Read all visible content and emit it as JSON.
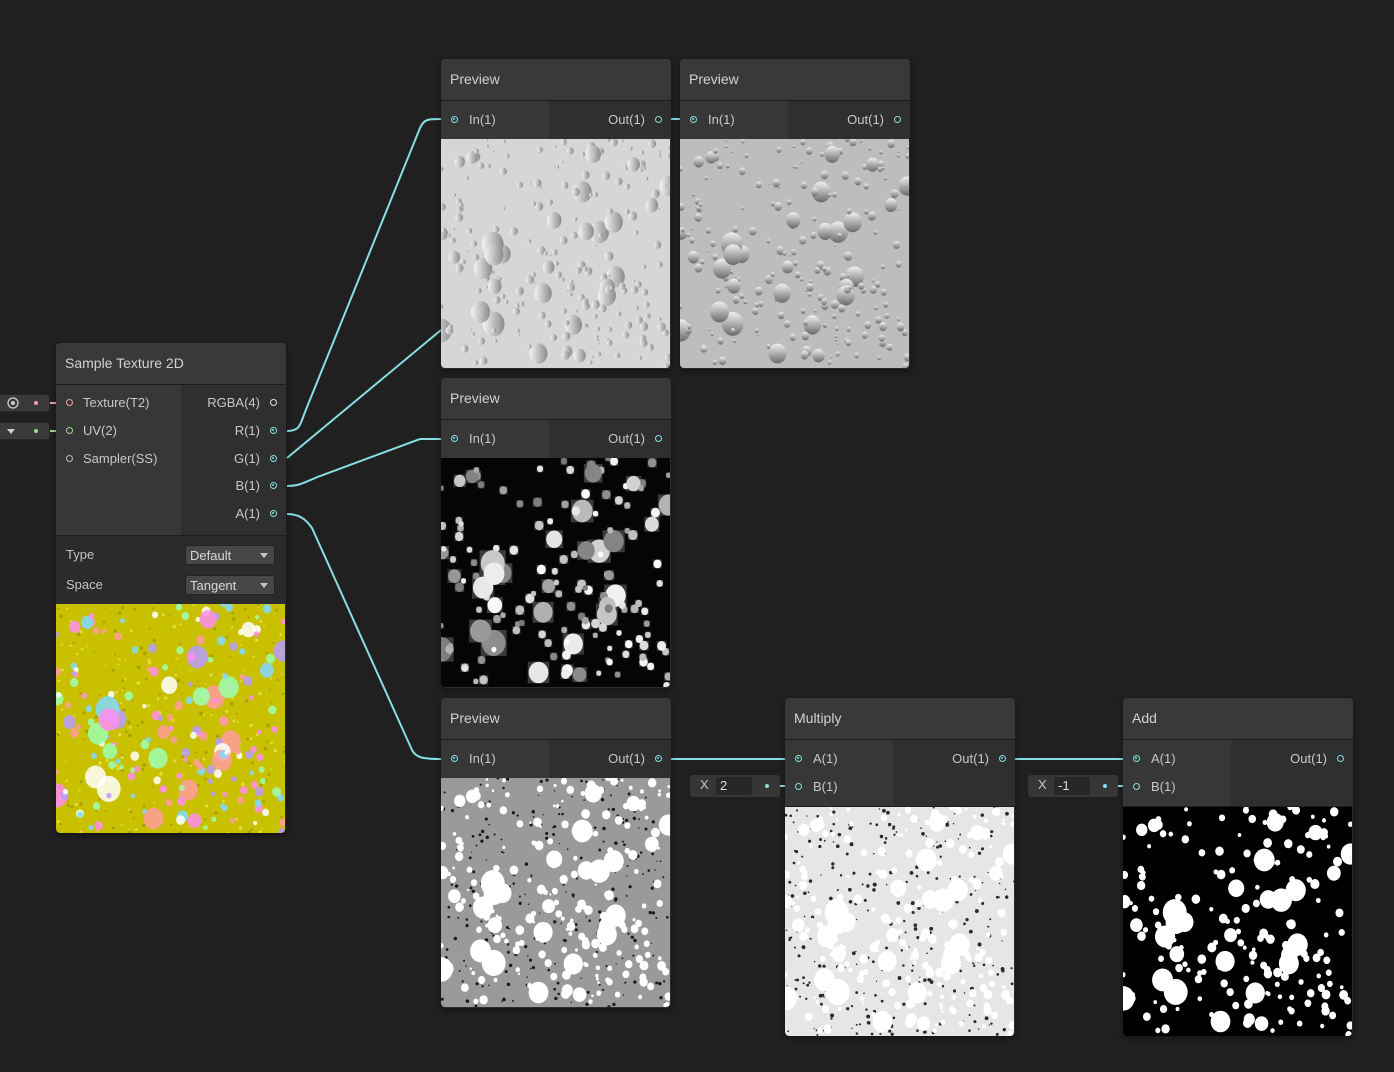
{
  "graph": {
    "wire_color": "#86dfe2",
    "texture_wire_color": "#f2a0a4",
    "uv_wire_color": "#9bdc8a"
  },
  "sample_texture": {
    "title": "Sample Texture 2D",
    "inputs": [
      "Texture(T2)",
      "UV(2)",
      "Sampler(SS)"
    ],
    "outputs": [
      "RGBA(4)",
      "R(1)",
      "G(1)",
      "B(1)",
      "A(1)"
    ],
    "type_label": "Type",
    "type_value": "Default",
    "space_label": "Space",
    "space_value": "Tangent",
    "preview_base_color": "#c9c000"
  },
  "preview_r": {
    "title": "Preview",
    "in": "In(1)",
    "out": "Out(1)"
  },
  "preview_g": {
    "title": "Preview",
    "in": "In(1)",
    "out": "Out(1)"
  },
  "preview_r2": {
    "title": "Preview",
    "in": "In(1)",
    "out": "Out(1)"
  },
  "preview_a": {
    "title": "Preview",
    "in": "In(1)",
    "out": "Out(1)"
  },
  "multiply": {
    "title": "Multiply",
    "in_a": "A(1)",
    "in_b": "B(1)",
    "out": "Out(1)",
    "b_axis": "X",
    "b_value": "2"
  },
  "add": {
    "title": "Add",
    "in_a": "A(1)",
    "in_b": "B(1)",
    "out": "Out(1)",
    "b_axis": "X",
    "b_value": "-1"
  }
}
